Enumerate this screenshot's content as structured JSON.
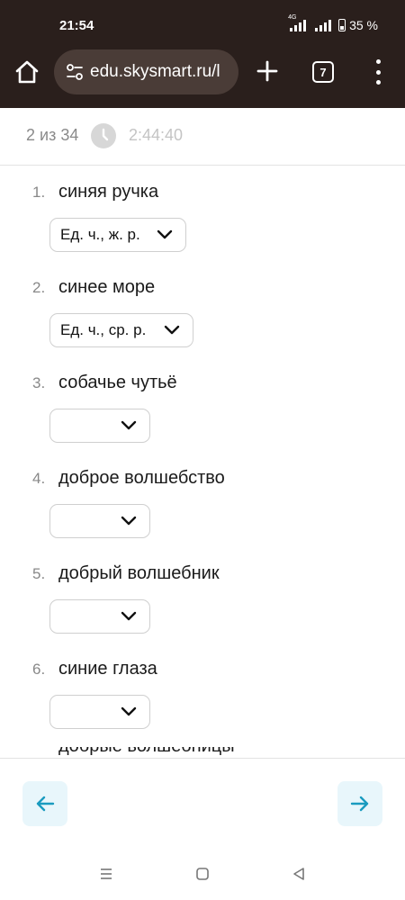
{
  "status_bar": {
    "time": "21:54",
    "network": "4G",
    "battery": "35 %"
  },
  "browser": {
    "url": "edu.skysmart.ru/l",
    "tab_count": "7",
    "icons": [
      "home-icon",
      "site-settings-icon",
      "plus-icon",
      "tabs-icon",
      "more-vert-icon"
    ]
  },
  "progress": {
    "counter": "2 из 34",
    "timer": "2:44:40"
  },
  "questions": [
    {
      "num": "1.",
      "text": "синяя ручка",
      "answer": "Ед. ч., ж. р."
    },
    {
      "num": "2.",
      "text": "синее море",
      "answer": "Ед. ч., ср. р."
    },
    {
      "num": "3.",
      "text": "собачье чутьё",
      "answer": ""
    },
    {
      "num": "4.",
      "text": "доброе волшебство",
      "answer": ""
    },
    {
      "num": "5.",
      "text": "добрый волшебник",
      "answer": ""
    },
    {
      "num": "6.",
      "text": "синие глаза",
      "answer": ""
    }
  ],
  "cut_off_text": "добрые волшебницы",
  "colors": {
    "chrome_bg": "#2a1f1c",
    "nav_button_bg": "#e8f6fb",
    "nav_arrow": "#1a9bbf"
  }
}
